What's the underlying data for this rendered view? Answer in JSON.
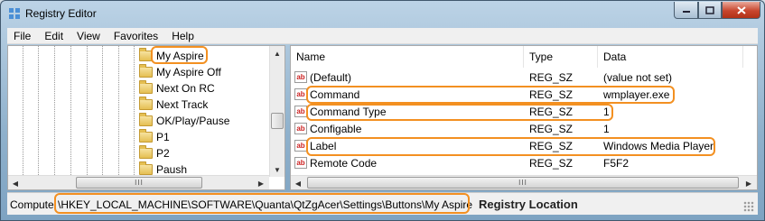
{
  "window": {
    "title": "Registry Editor"
  },
  "menu": [
    "File",
    "Edit",
    "View",
    "Favorites",
    "Help"
  ],
  "tree": {
    "items": [
      "My Aspire",
      "My Aspire Off",
      "Next On RC",
      "Next Track",
      "OK/Play/Pause",
      "P1",
      "P2",
      "Paush"
    ]
  },
  "list": {
    "headers": {
      "name": "Name",
      "type": "Type",
      "data": "Data"
    },
    "rows": [
      {
        "name": "(Default)",
        "type": "REG_SZ",
        "data": "(value not set)"
      },
      {
        "name": "Command",
        "type": "REG_SZ",
        "data": "wmplayer.exe"
      },
      {
        "name": "Command Type",
        "type": "REG_SZ",
        "data": "1"
      },
      {
        "name": "Configable",
        "type": "REG_SZ",
        "data": "1"
      },
      {
        "name": "Label",
        "type": "REG_SZ",
        "data": "Windows Media Player"
      },
      {
        "name": "Remote Code",
        "type": "REG_SZ",
        "data": "F5F2"
      }
    ]
  },
  "status": {
    "prefix": "Compute",
    "path": "\\HKEY_LOCAL_MACHINE\\SOFTWARE\\Quanta\\QtZgAcer\\Settings\\Buttons\\My Aspire",
    "annotation": "Registry Location"
  },
  "icons": {
    "value": "ab",
    "highlight_color": "#f39021"
  }
}
